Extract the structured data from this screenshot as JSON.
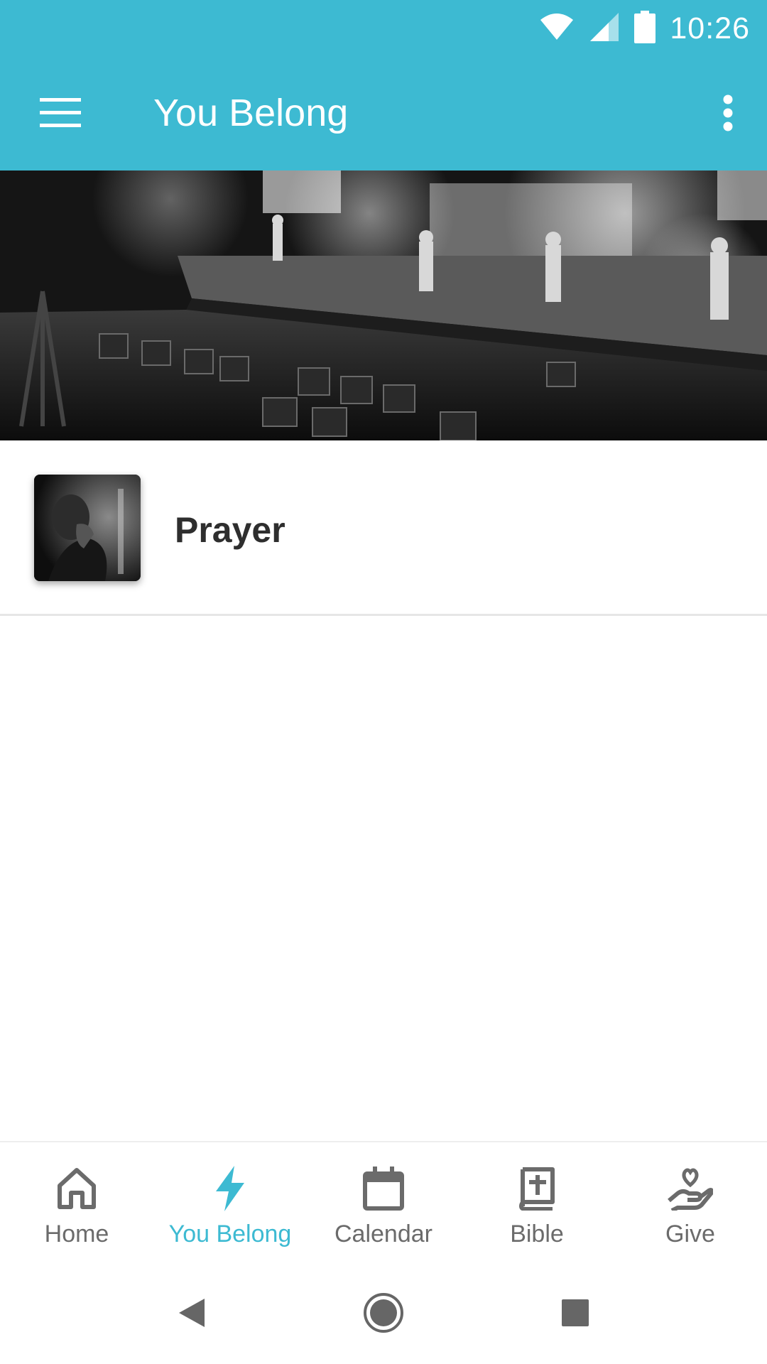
{
  "status_bar": {
    "time": "10:26",
    "icons": [
      "wifi-icon",
      "cell-signal-icon",
      "battery-icon"
    ]
  },
  "app_bar": {
    "title": "You Belong",
    "menu_icon": "hamburger-menu-icon",
    "overflow_icon": "more-vert-icon"
  },
  "hero": {
    "description_icon": "stage-photo"
  },
  "list": {
    "items": [
      {
        "label": "Prayer",
        "thumbnail": "prayer-photo"
      }
    ]
  },
  "bottom_nav": {
    "items": [
      {
        "label": "Home",
        "icon": "home-icon",
        "active": false
      },
      {
        "label": "You Belong",
        "icon": "bolt-icon",
        "active": true
      },
      {
        "label": "Calendar",
        "icon": "calendar-icon",
        "active": false
      },
      {
        "label": "Bible",
        "icon": "bible-icon",
        "active": false
      },
      {
        "label": "Give",
        "icon": "give-heart-hand-icon",
        "active": false
      }
    ]
  },
  "system_nav": {
    "icons": [
      "back-icon",
      "home-circle-icon",
      "recents-icon"
    ]
  },
  "colors": {
    "accent": "#3dbad2",
    "text_dark": "#2e2e2e",
    "nav_inactive": "#6b6b6b"
  }
}
